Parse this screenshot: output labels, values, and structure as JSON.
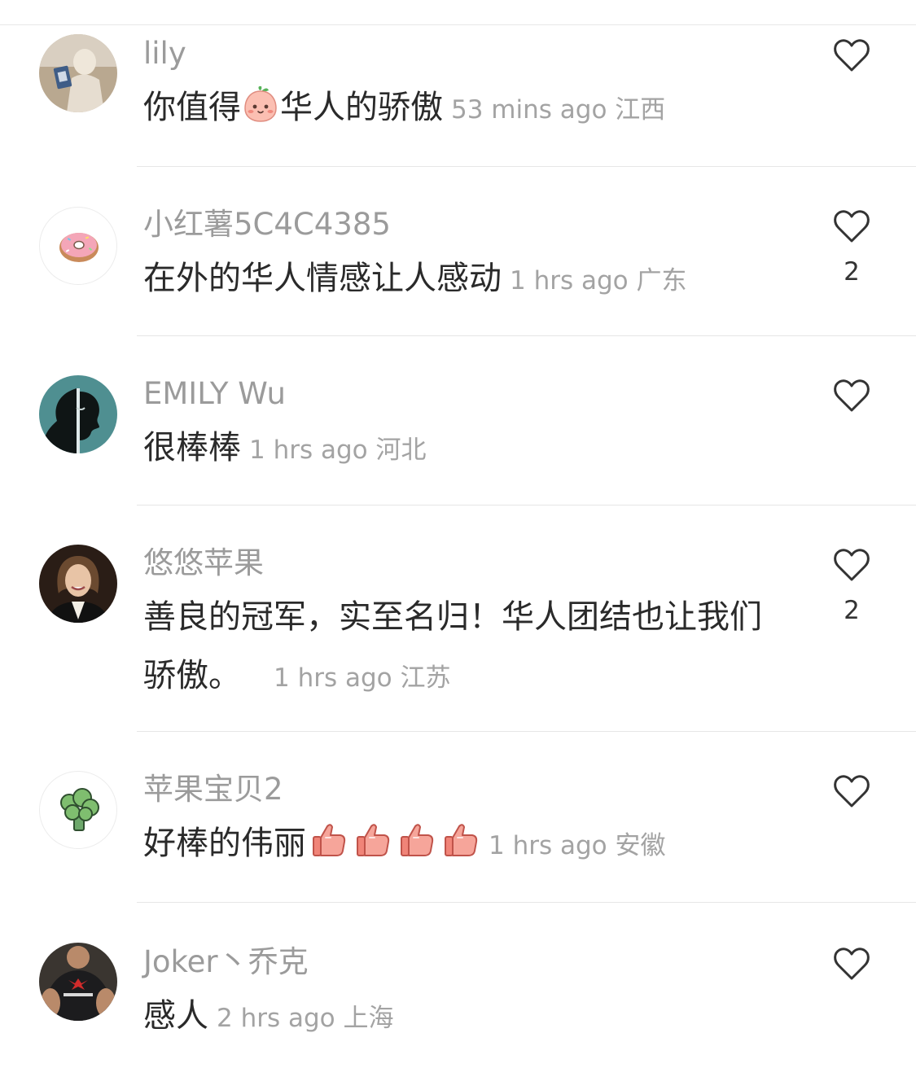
{
  "comments": [
    {
      "username": "lily",
      "text": "你值得",
      "emoji": "peach-face",
      "text2": "华人的骄傲",
      "time": "53 mins ago",
      "location": "江西",
      "likes": ""
    },
    {
      "username": "小红薯5C4C4385",
      "text": "在外的华人情感让人感动",
      "time": "1 hrs ago",
      "location": "广东",
      "likes": "2"
    },
    {
      "username": "EMILY Wu",
      "text": "很棒棒",
      "time": "1 hrs ago",
      "location": "河北",
      "likes": ""
    },
    {
      "username": "悠悠苹果",
      "text": "善良的冠军，实至名归！华人团结也让我们骄傲。",
      "time": "1 hrs ago",
      "location": "江苏",
      "likes": "2"
    },
    {
      "username": "苹果宝贝2",
      "text": "好棒的伟丽",
      "emoji": "thumbs-up",
      "emoji_count": 4,
      "time": "1 hrs ago",
      "location": "安徽",
      "likes": ""
    },
    {
      "username": "Joker丶乔克",
      "text": "感人",
      "time": "2 hrs ago",
      "location": "上海",
      "likes": ""
    }
  ],
  "icons": {
    "like": "heart-outline-icon"
  },
  "colors": {
    "muted_text": "#9b9b9b",
    "divider": "#e6e6e6"
  }
}
